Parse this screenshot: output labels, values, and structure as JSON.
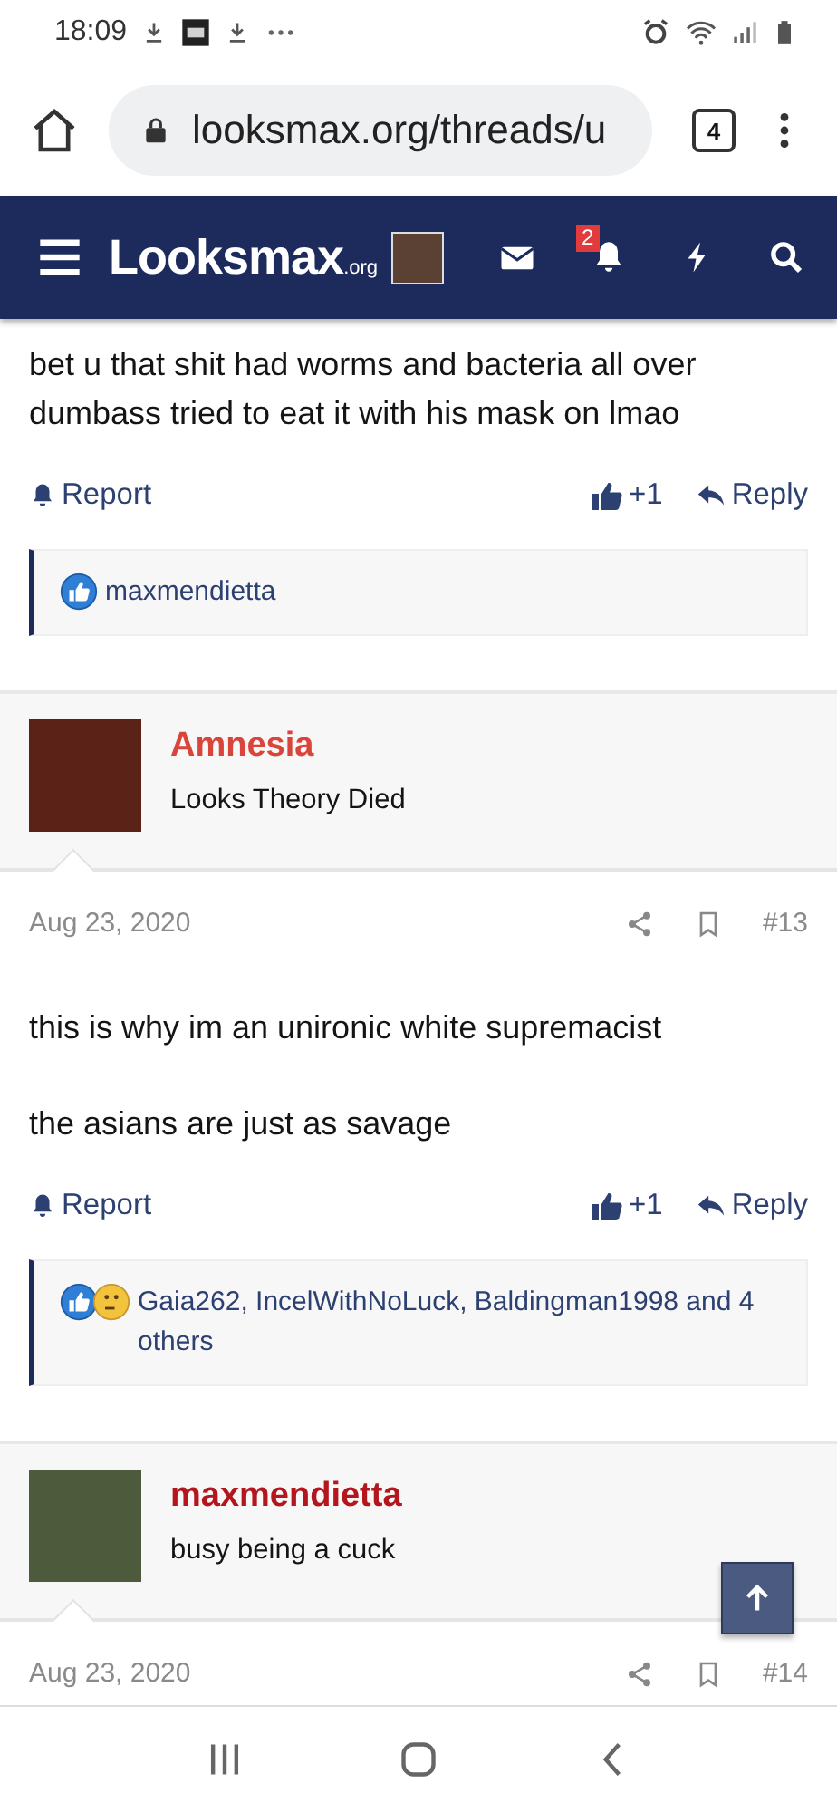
{
  "status_bar": {
    "time": "18:09"
  },
  "browser": {
    "url": "looksmax.org/threads/u",
    "tab_count": "4"
  },
  "site_header": {
    "logo": "Looksmax",
    "logo_suffix": ".org",
    "notification_count": "2"
  },
  "posts": [
    {
      "kind": "tail",
      "body": [
        "bet u that shit had worms and bacteria all over dumbass tried to eat it with his mask on lmao"
      ],
      "report": "Report",
      "like_count": "+1",
      "reply": "Reply",
      "reactions": "maxmendietta"
    },
    {
      "kind": "full",
      "author": "Amnesia",
      "color": "#d9453a",
      "user_title": "Looks Theory Died",
      "date": "Aug 23, 2020",
      "number": "#13",
      "body": [
        "this is why im an unironic white supremacist",
        "the asians are just as savage"
      ],
      "report": "Report",
      "like_count": "+1",
      "reply": "Reply",
      "reactions": "Gaia262, IncelWithNoLuck, Baldingman1998 and 4 others"
    },
    {
      "kind": "cut",
      "author": "maxmendietta",
      "color": "#b3161c",
      "user_title": "busy being a cuck",
      "date": "Aug 23, 2020",
      "number": "#14"
    }
  ]
}
